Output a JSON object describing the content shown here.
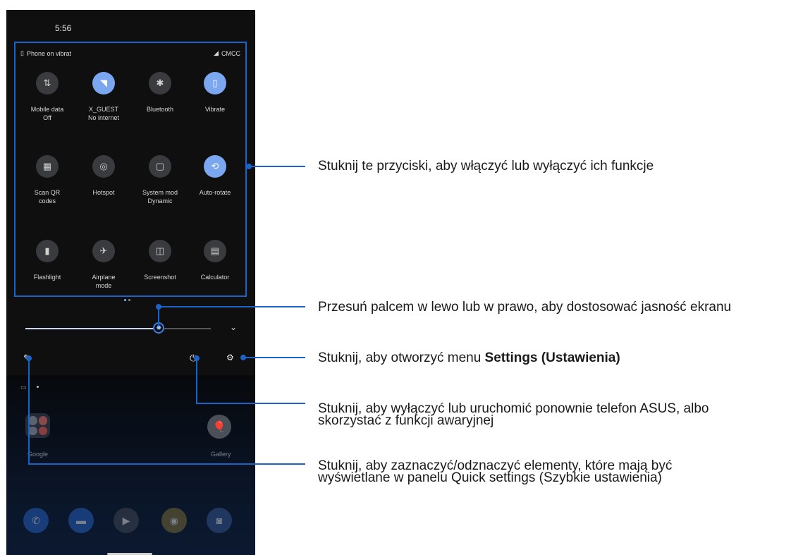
{
  "phone": {
    "time": "5:56",
    "status_left": "Phone on vibrat",
    "status_right": "CMCC",
    "tiles": [
      {
        "label": "Mobile data\nOff",
        "icon": "mobile-data-icon",
        "glyph": "⇅",
        "on": false
      },
      {
        "label": "X_GUEST\nNo internet",
        "icon": "wifi-icon",
        "glyph": "◥",
        "on": true
      },
      {
        "label": "Bluetooth",
        "icon": "bluetooth-icon",
        "glyph": "✱",
        "on": false
      },
      {
        "label": "Vibrate",
        "icon": "vibrate-icon",
        "glyph": "▯",
        "on": true
      },
      {
        "label": "Scan QR\ncodes",
        "icon": "qr-code-icon",
        "glyph": "▦",
        "on": false
      },
      {
        "label": "Hotspot",
        "icon": "hotspot-icon",
        "glyph": "◎",
        "on": false
      },
      {
        "label": "System mod\nDynamic",
        "icon": "system-mode-icon",
        "glyph": "▢",
        "on": false
      },
      {
        "label": "Auto-rotate",
        "icon": "auto-rotate-icon",
        "glyph": "⟲",
        "on": true
      },
      {
        "label": "Flashlight",
        "icon": "flashlight-icon",
        "glyph": "▮",
        "on": false
      },
      {
        "label": "Airplane\nmode",
        "icon": "airplane-icon",
        "glyph": "✈",
        "on": false
      },
      {
        "label": "Screenshot",
        "icon": "screenshot-icon",
        "glyph": "◫",
        "on": false
      },
      {
        "label": "Calculator",
        "icon": "calculator-icon",
        "glyph": "▤",
        "on": false
      }
    ],
    "brightness_percent": 72,
    "home": {
      "folder_label": "Google",
      "gallery_label": "Gallery"
    }
  },
  "callouts": {
    "toggles": "Stuknij te przyciski, aby włączyć lub wyłączyć ich funkcje",
    "brightness": "Przesuń palcem w lewo lub w prawo, aby dostosować jasność ekranu",
    "settings_prefix": "Stuknij, aby otworzyć menu ",
    "settings_bold": "Settings (Ustawienia)",
    "power_line1": "Stuknij, aby wyłączyć lub uruchomić ponownie telefon ASUS, albo",
    "power_line2": "skorzystać z funkcji awaryjnej",
    "edit_line1": "Stuknij, aby zaznaczyć/odznaczyć elementy, które mają być",
    "edit_line2": "wyświetlane w panelu Quick settings (Szybkie ustawienia)"
  },
  "colors": {
    "accent": "#1a64c8",
    "tile_on": "#7aa7ef",
    "tile_off": "#3a3b3e"
  }
}
